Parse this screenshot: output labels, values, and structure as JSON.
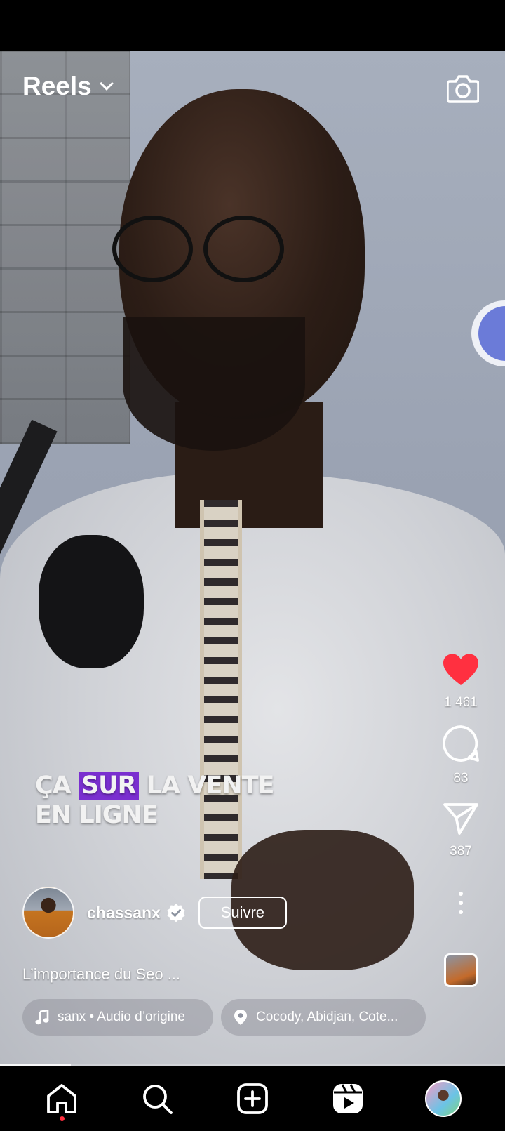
{
  "header": {
    "title": "Reels",
    "dropdown_icon": "chevron-down-icon",
    "camera_icon": "camera-icon"
  },
  "video": {
    "caption_overlay": {
      "line1_before": "ÇA",
      "line1_highlight": "SUR",
      "line1_after": "LA VENTE",
      "line2": "EN LIGNE"
    },
    "highlight_color": "#7a2fd0",
    "progress": 0.14
  },
  "actions": {
    "like": {
      "icon": "heart-icon",
      "count": "1 461",
      "liked": true,
      "color": "#ff3040"
    },
    "comment": {
      "icon": "comment-icon",
      "count": "83"
    },
    "share": {
      "icon": "send-icon",
      "count": "387"
    },
    "more": {
      "icon": "more-vertical-icon"
    }
  },
  "author": {
    "username": "chassanx",
    "verified": true,
    "follow_label": "Suivre"
  },
  "description": "L’importance du Seo ...",
  "audio": {
    "icon": "music-note-icon",
    "label": "sanx • Audio d’origine"
  },
  "location": {
    "icon": "location-pin-icon",
    "label": "Cocody, Abidjan, Cote..."
  },
  "bottom_nav": [
    {
      "name": "home",
      "icon": "home-icon",
      "active": true
    },
    {
      "name": "search",
      "icon": "search-icon"
    },
    {
      "name": "create",
      "icon": "plus-square-icon"
    },
    {
      "name": "reels",
      "icon": "reels-icon"
    },
    {
      "name": "profile",
      "icon": "profile-avatar"
    }
  ]
}
